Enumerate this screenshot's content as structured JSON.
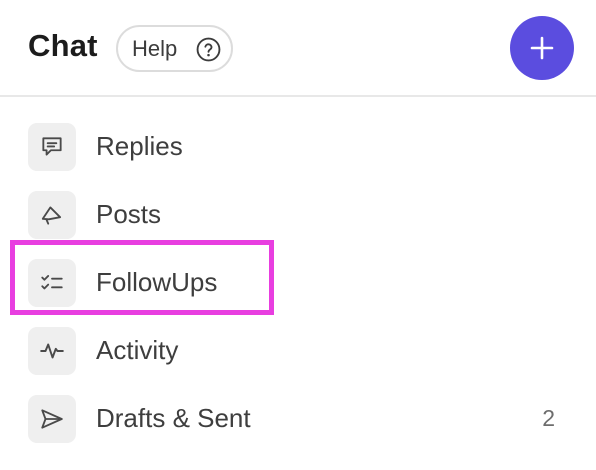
{
  "header": {
    "title": "Chat",
    "help_label": "Help",
    "help_icon": "question-circle-icon",
    "add_icon": "plus-icon",
    "add_color": "#5b4ddf"
  },
  "nav": {
    "items": [
      {
        "label": "Replies",
        "icon": "speech-bubble-icon",
        "count": ""
      },
      {
        "label": "Posts",
        "icon": "megaphone-icon",
        "count": ""
      },
      {
        "label": "FollowUps",
        "icon": "checklist-icon",
        "count": ""
      },
      {
        "label": "Activity",
        "icon": "pulse-icon",
        "count": ""
      },
      {
        "label": "Drafts & Sent",
        "icon": "paper-plane-icon",
        "count": "2"
      }
    ]
  },
  "highlight_color": "#e83ee0"
}
